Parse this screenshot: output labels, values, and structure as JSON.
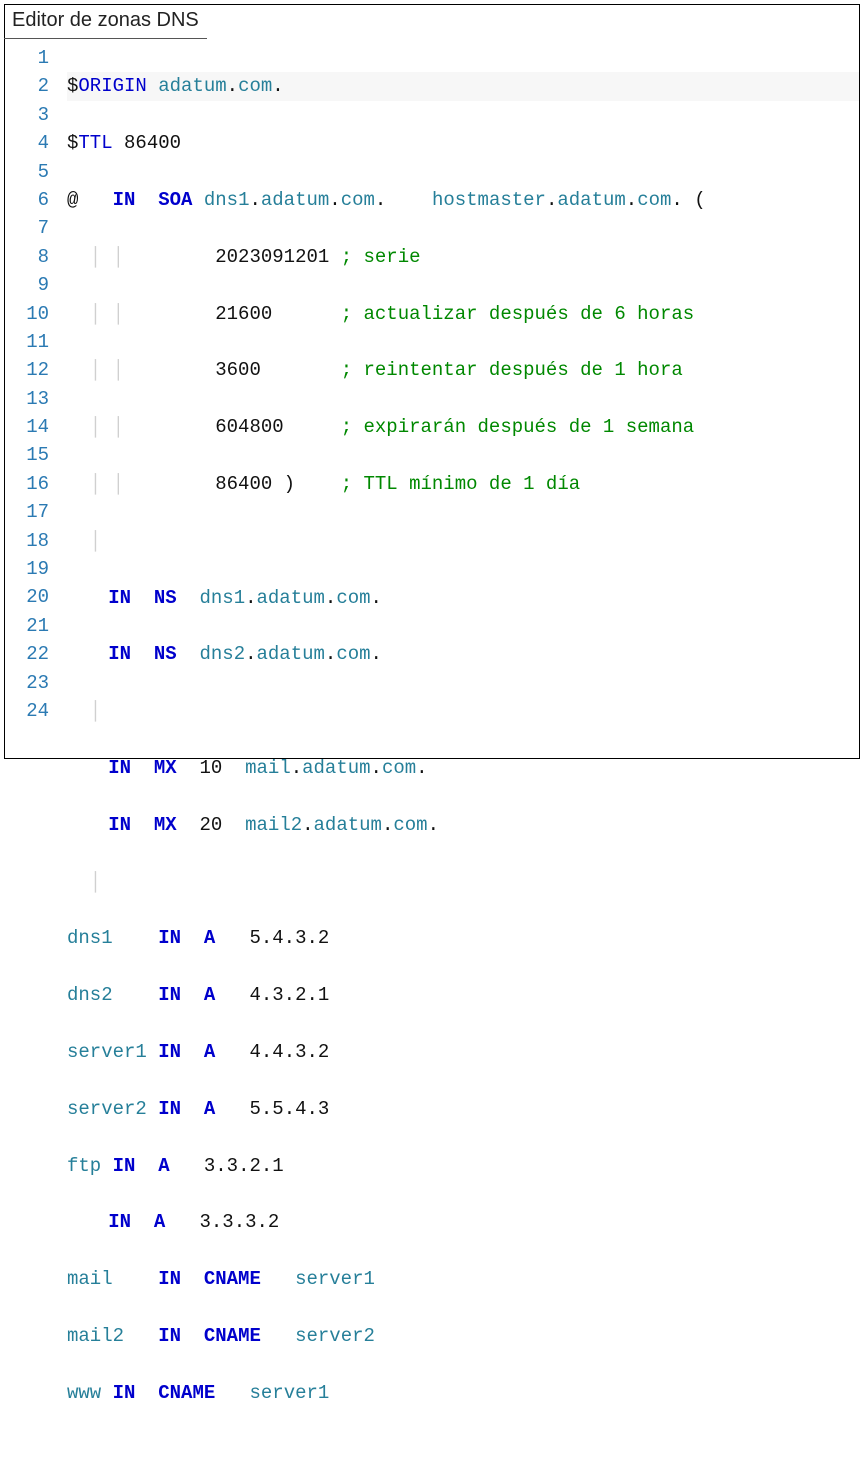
{
  "title": "Editor de zonas DNS",
  "line_count": 24,
  "tokens": {
    "l1": {
      "a": "$",
      "b": "ORIGIN",
      "c": " ",
      "d": "adatum",
      "e": ".",
      "f": "com",
      "g": "."
    },
    "l2": {
      "a": "$",
      "b": "TTL",
      "c": " ",
      "d": "86400"
    },
    "l3": {
      "a": "@   ",
      "b": "IN",
      "c": "  ",
      "d": "SOA",
      "e": " ",
      "f": "dns1",
      "g": ".",
      "h": "adatum",
      "i": ".",
      "j": "com",
      "k": ".    ",
      "l": "hostmaster",
      "m": ".",
      "n": "adatum",
      "o": ".",
      "p": "com",
      "q": ". ("
    },
    "l4": {
      "pad": "              ",
      "a": "2023091201",
      "b": " ",
      "c": "; serie"
    },
    "l5": {
      "pad": "              ",
      "a": "21600",
      "b": "      ",
      "c": "; actualizar después de 6 horas"
    },
    "l6": {
      "pad": "              ",
      "a": "3600",
      "b": "       ",
      "c": "; reintentar después de 1 hora"
    },
    "l7": {
      "pad": "              ",
      "a": "604800",
      "b": "     ",
      "c": "; expirarán después de 1 semana"
    },
    "l8": {
      "pad": "              ",
      "a": "86400",
      "b": " )    ",
      "c": "; TTL mínimo de 1 día"
    },
    "l10": {
      "pad": "    ",
      "a": "IN",
      "b": "  ",
      "c": "NS",
      "d": "  ",
      "e": "dns1",
      "f": ".",
      "g": "adatum",
      "h": ".",
      "i": "com",
      "j": "."
    },
    "l11": {
      "pad": "    ",
      "a": "IN",
      "b": "  ",
      "c": "NS",
      "d": "  ",
      "e": "dns2",
      "f": ".",
      "g": "adatum",
      "h": ".",
      "i": "com",
      "j": "."
    },
    "l13": {
      "pad": "    ",
      "a": "IN",
      "b": "  ",
      "c": "MX",
      "d": "  ",
      "e": "10",
      "f": "  ",
      "g": "mail",
      "h": ".",
      "i": "adatum",
      "j": ".",
      "k": "com",
      "l": "."
    },
    "l14": {
      "pad": "    ",
      "a": "IN",
      "b": "  ",
      "c": "MX",
      "d": "  ",
      "e": "20",
      "f": "  ",
      "g": "mail2",
      "h": ".",
      "i": "adatum",
      "j": ".",
      "k": "com",
      "l": "."
    },
    "l16": {
      "a": "dns1",
      "b": "    ",
      "c": "IN",
      "d": "  ",
      "e": "A",
      "f": "   ",
      "g": "5.4.3.2"
    },
    "l17": {
      "a": "dns2",
      "b": "    ",
      "c": "IN",
      "d": "  ",
      "e": "A",
      "f": "   ",
      "g": "4.3.2.1"
    },
    "l18": {
      "a": "server1",
      "b": " ",
      "c": "IN",
      "d": "  ",
      "e": "A",
      "f": "   ",
      "g": "4.4.3.2"
    },
    "l19": {
      "a": "server2",
      "b": " ",
      "c": "IN",
      "d": "  ",
      "e": "A",
      "f": "   ",
      "g": "5.5.4.3"
    },
    "l20": {
      "a": "ftp",
      "b": " ",
      "c": "IN",
      "d": "  ",
      "e": "A",
      "f": "   ",
      "g": "3.3.2.1"
    },
    "l21": {
      "pad": "    ",
      "c": "IN",
      "d": "  ",
      "e": "A",
      "f": "   ",
      "g": "3.3.3.2"
    },
    "l22": {
      "a": "mail",
      "b": "    ",
      "c": "IN",
      "d": "  ",
      "e": "CNAME",
      "f": "   ",
      "g": "server1"
    },
    "l23": {
      "a": "mail2",
      "b": "   ",
      "c": "IN",
      "d": "  ",
      "e": "CNAME",
      "f": "   ",
      "g": "server2"
    },
    "l24": {
      "a": "www",
      "b": " ",
      "c": "IN",
      "d": "  ",
      "e": "CNAME",
      "f": "   ",
      "g": "server1"
    }
  }
}
